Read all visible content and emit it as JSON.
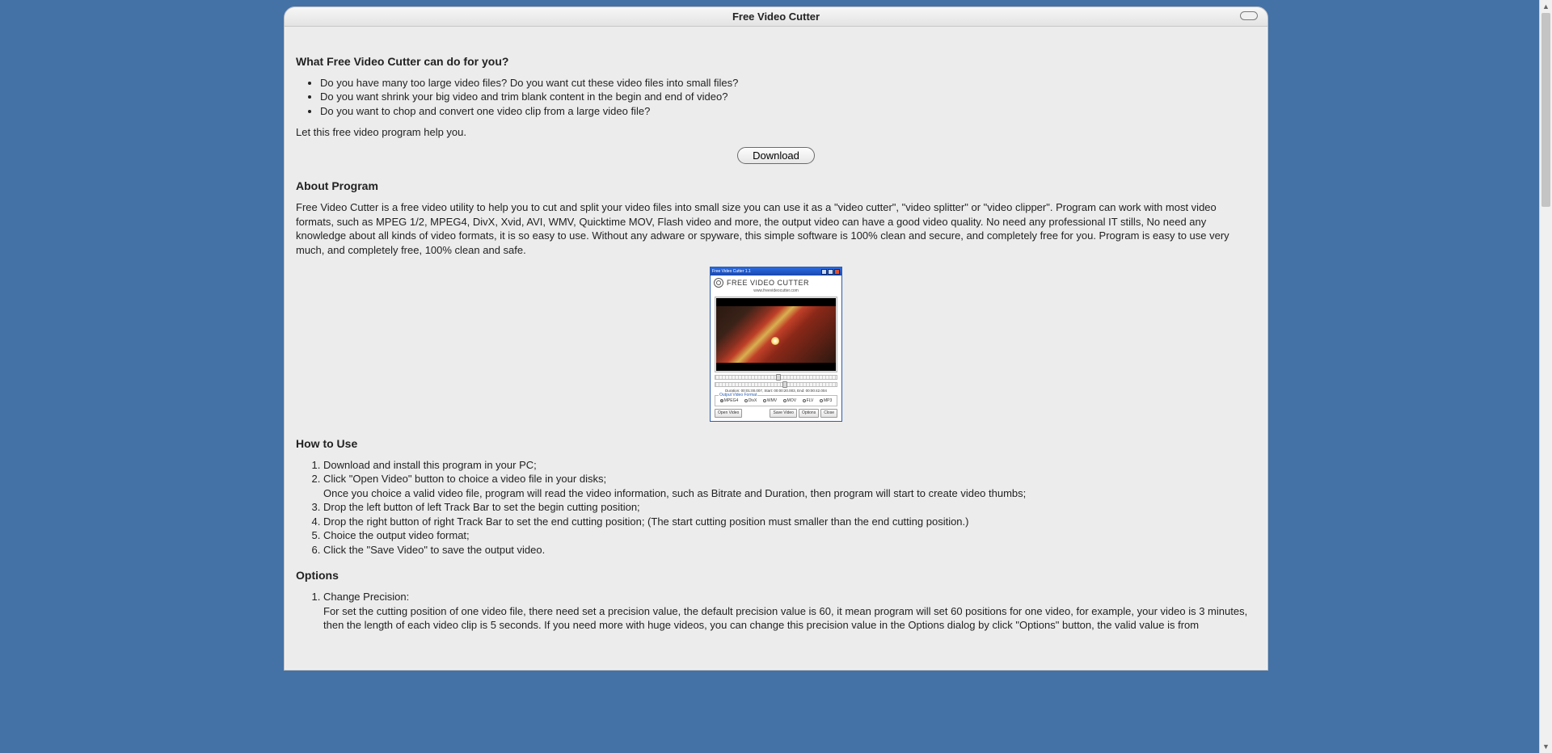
{
  "window": {
    "title": "Free Video Cutter"
  },
  "section1": {
    "heading": "What Free Video Cutter can do for you?",
    "bullets": [
      "Do you have many too large video files? Do you want cut these video files into small files?",
      "Do you want shrink your big video and trim blank content in the begin and end of video?",
      "Do you want to chop and convert one video clip from a large video file?"
    ],
    "closing": "Let this free video program help you."
  },
  "download_label": "Download",
  "about": {
    "heading": "About Program",
    "body": "Free Video Cutter is a free video utility to help you to cut and split your video files into small size you can use it as a \"video cutter\", \"video splitter\" or \"video clipper\". Program can work with most video formats, such as MPEG 1/2, MPEG4, DivX, Xvid, AVI, WMV, Quicktime MOV, Flash video and more, the output video can have a good video quality. No need any professional IT stills, No need any knowledge about all kinds of video formats, it is so easy to use. Without any adware or spyware, this simple software is 100% clean and secure, and completely free for you. Program is easy to use very much, and completely free, 100% clean and safe."
  },
  "screenshot": {
    "titlebar": "Free Video Cutter 1.1",
    "brand": "FREE VIDEO CUTTER",
    "url": "www.freevideocutter.com",
    "duration": "Duration: 00:01:00.007, Start: 00:00:20.003, End: 00:00:42.004",
    "group_label": "Output Video Format",
    "formats": [
      "MPEG4",
      "DivX",
      "WMV",
      "MOV",
      "FLV",
      "MP3"
    ],
    "selected_format": "MPEG4",
    "buttons": {
      "open": "Open Video",
      "save": "Save Video",
      "options": "Options",
      "close": "Close"
    }
  },
  "howto": {
    "heading": "How to Use",
    "step1": "Download and install this program in your PC;",
    "step2a": "Click \"Open Video\" button to choice a video file in your disks;",
    "step2b": "Once you choice a valid video file, program will read the video information, such as Bitrate and Duration, then program will start to create video thumbs;",
    "step3": "Drop the left button of left Track Bar to set the begin cutting position;",
    "step4": "Drop the right button of right Track Bar to set the end cutting position; (The start cutting position must smaller than the end cutting position.)",
    "step5": "Choice the output video format;",
    "step6": "Click the \"Save Video\" to save the output video."
  },
  "options": {
    "heading": "Options",
    "item1_title": "Change Precision:",
    "item1_body": "For set the cutting position of one video file, there need set a precision value, the default precision value is 60, it mean program will set 60 positions for one video, for example, your video is 3 minutes, then the length of each video clip is 5 seconds. If you need more with huge videos, you can change this precision value in the Options dialog by click \"Options\" button, the valid value is from"
  }
}
